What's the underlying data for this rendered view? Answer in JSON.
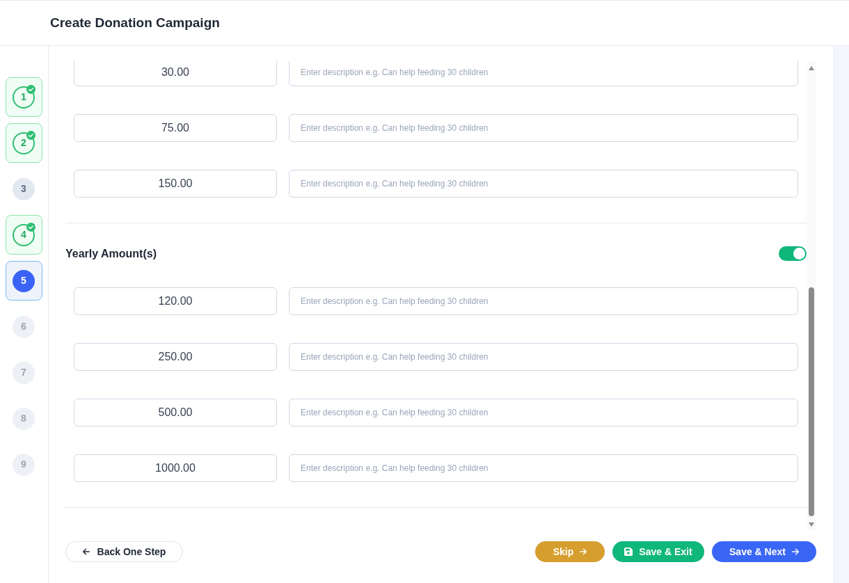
{
  "header": {
    "title": "Create Donation Campaign"
  },
  "steps": [
    {
      "label": "1",
      "completed": true,
      "selected": false,
      "disabled": false
    },
    {
      "label": "2",
      "completed": true,
      "selected": false,
      "disabled": false
    },
    {
      "label": "3",
      "completed": false,
      "selected": false,
      "disabled": false
    },
    {
      "label": "4",
      "completed": true,
      "selected": false,
      "disabled": false
    },
    {
      "label": "5",
      "completed": false,
      "selected": true,
      "disabled": false
    },
    {
      "label": "6",
      "completed": false,
      "selected": false,
      "disabled": true
    },
    {
      "label": "7",
      "completed": false,
      "selected": false,
      "disabled": true
    },
    {
      "label": "8",
      "completed": false,
      "selected": false,
      "disabled": true
    },
    {
      "label": "9",
      "completed": false,
      "selected": false,
      "disabled": true
    }
  ],
  "amount_groups": [
    {
      "rows": [
        {
          "amount": "30.00",
          "description_placeholder": "Enter description e.g. Can help feeding 30 children"
        },
        {
          "amount": "75.00",
          "description_placeholder": "Enter description e.g. Can help feeding 30 children"
        },
        {
          "amount": "150.00",
          "description_placeholder": "Enter description e.g. Can help feeding 30 children"
        }
      ]
    },
    {
      "title": "Yearly Amount(s)",
      "toggle": {
        "on": true
      },
      "rows": [
        {
          "amount": "120.00",
          "description_placeholder": "Enter description e.g. Can help feeding 30 children"
        },
        {
          "amount": "250.00",
          "description_placeholder": "Enter description e.g. Can help feeding 30 children"
        },
        {
          "amount": "500.00",
          "description_placeholder": "Enter description e.g. Can help feeding 30 children"
        },
        {
          "amount": "1000.00",
          "description_placeholder": "Enter description e.g. Can help feeding 30 children"
        }
      ]
    }
  ],
  "footer": {
    "back_button": {
      "label": "Back One Step"
    },
    "actions": [
      {
        "kind": "skip",
        "label": "Skip"
      },
      {
        "kind": "save_exit",
        "label": "Save & Exit"
      },
      {
        "kind": "save_next",
        "label": "Save & Next"
      }
    ]
  }
}
